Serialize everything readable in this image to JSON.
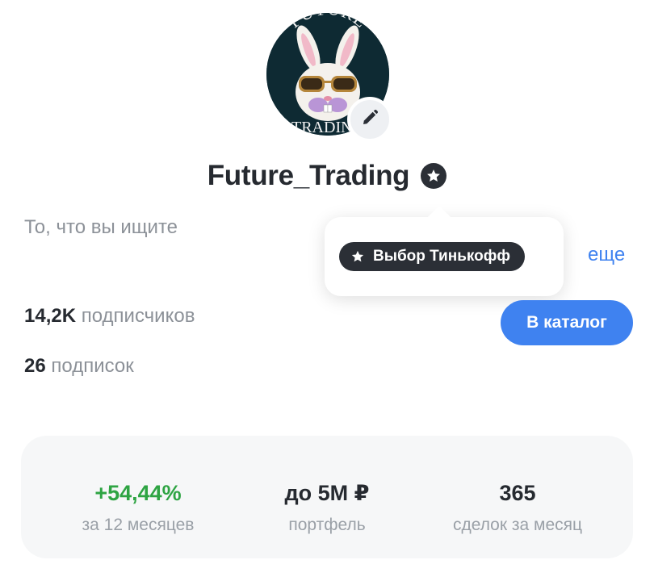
{
  "profile": {
    "avatar_text_top": "FUTURE",
    "avatar_text_bottom": "TRADING",
    "username": "Future_Trading",
    "bio": "То, что вы ищите",
    "more_link": "еще",
    "followers_count": "14,2K",
    "followers_label": "подписчиков",
    "following_count": "26",
    "following_label": "подписок",
    "catalog_button": "В каталог"
  },
  "tooltip": {
    "badge_label": "Выбор Тинькофф"
  },
  "metrics": [
    {
      "value": "+54,44%",
      "label": "за 12 месяцев"
    },
    {
      "value": "до 5М ₽",
      "label": "портфель"
    },
    {
      "value": "365",
      "label": "сделок за месяц"
    }
  ],
  "colors": {
    "accent": "#3f82f0",
    "positive": "#2ea443",
    "dark_badge": "#2b2f36",
    "muted_text": "#8c9198"
  },
  "icons": [
    "pencil-icon",
    "star-icon"
  ]
}
